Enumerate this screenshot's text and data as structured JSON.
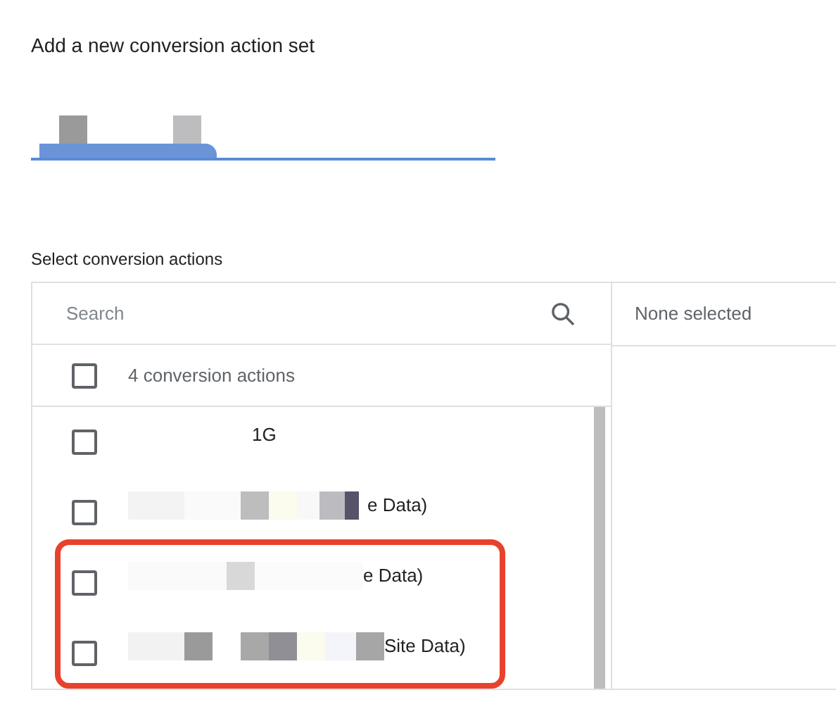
{
  "heading": "Add a new conversion action set",
  "name_field": {
    "focused": true
  },
  "section_label": "Select conversion actions",
  "search": {
    "placeholder": "Search"
  },
  "select_all": {
    "label": "4 conversion actions",
    "checked": false
  },
  "actions": [
    {
      "title": "1G",
      "checked": false,
      "highlighted": false
    },
    {
      "title": "e Data)",
      "checked": false,
      "highlighted": false
    },
    {
      "title": "e Data)",
      "checked": false,
      "highlighted": true
    },
    {
      "title": "Site Data)",
      "checked": false,
      "highlighted": true
    }
  ],
  "selected_panel": {
    "empty_text": "None selected"
  }
}
